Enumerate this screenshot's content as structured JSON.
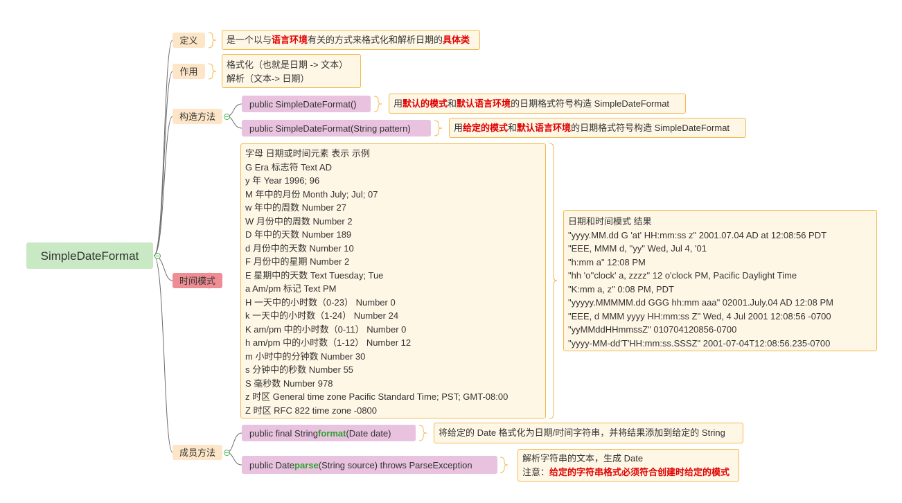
{
  "root": "SimpleDateFormat",
  "branches": {
    "definition": {
      "label": "定义",
      "note": [
        "是一个以与",
        "语言环境",
        "有关的方式来格式化和解析日期的",
        "具体类"
      ]
    },
    "usage": {
      "label": "作用",
      "lines": [
        "格式化（也就是日期 -> 文本）",
        "解析（文本-> 日期）"
      ]
    },
    "constructors": {
      "label": "构造方法",
      "items": [
        {
          "sig": "public SimpleDateFormat()",
          "desc": [
            "用",
            "默认的模式",
            "和",
            "默认语言环境",
            "的日期格式符号构造 SimpleDateFormat"
          ]
        },
        {
          "sig": "public SimpleDateFormat(String pattern)",
          "desc": [
            "用",
            "给定的模式",
            "和",
            "默认语言环境",
            "的日期格式符号构造 SimpleDateFormat"
          ]
        }
      ]
    },
    "patterns": {
      "label": "时间模式",
      "letters": [
        "字母  日期或时间元素  表示  示例",
        "G  Era 标志符  Text  AD",
        "y  年  Year  1996; 96",
        "M  年中的月份  Month  July; Jul; 07",
        "w  年中的周数  Number  27",
        "W  月份中的周数  Number  2",
        "D  年中的天数  Number  189",
        "d  月份中的天数  Number  10",
        "F  月份中的星期  Number  2",
        "E  星期中的天数  Text  Tuesday; Tue",
        "a  Am/pm 标记  Text  PM",
        "H  一天中的小时数（0-23）   Number  0",
        "k  一天中的小时数（1-24）   Number  24",
        "K  am/pm 中的小时数（0-11）   Number  0",
        "h  am/pm 中的小时数（1-12）   Number  12",
        "m  小时中的分钟数  Number  30",
        "s  分钟中的秒数  Number  55",
        "S  毫秒数  Number  978",
        "z  时区  General time zone  Pacific Standard Time; PST; GMT-08:00",
        "Z  时区  RFC 822 time zone  -0800"
      ],
      "examples": [
        "日期和时间模式  结果",
        "\"yyyy.MM.dd G 'at' HH:mm:ss z\"  2001.07.04 AD at 12:08:56 PDT",
        "\"EEE, MMM d, ''yy\"  Wed, Jul 4, '01",
        "\"h:mm a\"  12:08 PM",
        "\"hh 'o''clock' a, zzzz\"  12 o'clock PM, Pacific Daylight Time",
        "\"K:mm a, z\"  0:08 PM, PDT",
        "\"yyyyy.MMMMM.dd GGG hh:mm aaa\"  02001.July.04 AD 12:08 PM",
        "\"EEE, d MMM yyyy HH:mm:ss Z\"  Wed, 4 Jul 2001 12:08:56 -0700",
        "\"yyMMddHHmmssZ\"  010704120856-0700",
        "\"yyyy-MM-dd'T'HH:mm:ss.SSSZ\"  2001-07-04T12:08:56.235-0700"
      ]
    },
    "members": {
      "label": "成员方法",
      "items": [
        {
          "sig": [
            "public final String ",
            "format",
            "(Date date)"
          ],
          "desc": [
            "将给定的 Date 格式化为日期/时间字符串，并将结果添加到给定的 String"
          ]
        },
        {
          "sig": [
            "public Date ",
            "parse",
            "(String source) throws ParseException"
          ],
          "desc": [
            "解析字符串的文本，生成 Date",
            "注意：",
            "给定的字符串格式必须符合创建时给定的模式"
          ]
        }
      ]
    }
  },
  "colors": {
    "root_fill": "#c9e8c4",
    "branch_fill": "#fde6c8",
    "branch_highlight": "#ee8d93",
    "method_fill": "#e8c2de",
    "note_fill": "#fff7e6",
    "note_border": "#f2b84b",
    "emphasis_red": "#e00000",
    "emphasis_green": "#2ba42b",
    "connector": "#666666",
    "bracket": "#f2b84b",
    "toggle": "#4caf50"
  }
}
